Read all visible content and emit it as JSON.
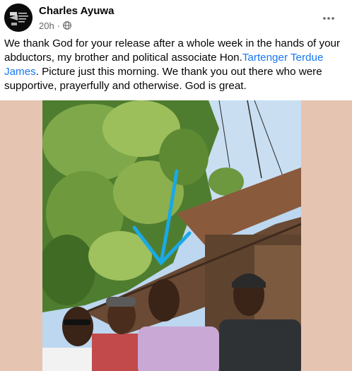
{
  "post": {
    "author": "Charles Ayuwa",
    "time": "20h",
    "separator": "·",
    "privacy_icon": "globe-icon",
    "more_icon": "more-options-icon",
    "text_before_mention": "We thank God for your release after a whole week in the hands of your abductors, my brother and political associate Hon.",
    "mention": "Tartenger Terdue James",
    "text_after_mention": ". Picture just this morning. We thank you out there who were supportive, prayerfully and otherwise. God is great.",
    "media_background": "#e6c4b2",
    "accent": "#1877f2"
  }
}
